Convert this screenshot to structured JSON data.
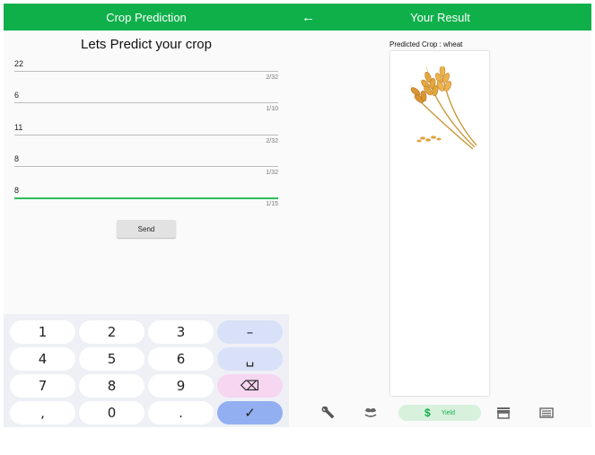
{
  "left_screen": {
    "appbar_title": "Crop Prediction",
    "heading": "Lets Predict your crop",
    "fields": [
      {
        "value": "22",
        "counter": "2/32"
      },
      {
        "value": "6",
        "counter": "1/10"
      },
      {
        "value": "11",
        "counter": "2/32"
      },
      {
        "value": "8",
        "counter": "1/32"
      },
      {
        "value": "8",
        "counter": "1/15"
      }
    ],
    "send_label": "Send",
    "keyboard": {
      "rows": [
        [
          "1",
          "2",
          "3",
          "–"
        ],
        [
          "4",
          "5",
          "6",
          "␣"
        ],
        [
          "7",
          "8",
          "9",
          "⌫"
        ],
        [
          ",",
          "0",
          ".",
          "✓"
        ]
      ]
    }
  },
  "right_screen": {
    "back_icon": "arrow-back-icon",
    "appbar_title": "Your Result",
    "prediction_text": "Predicted Crop : wheat",
    "bottom_nav": {
      "items": [
        "wrench-icon",
        "plant-icon",
        "dollar-icon",
        "store-icon",
        "list-icon"
      ],
      "active_label": "Yield"
    }
  },
  "colors": {
    "appbar": "#0fb04a",
    "active_underline": "#2ebd5b",
    "key_function": "#d8e1f8",
    "key_delete": "#f7d6f1",
    "key_done": "#92b0f1",
    "nav_active_bg": "#d7f1dd"
  }
}
